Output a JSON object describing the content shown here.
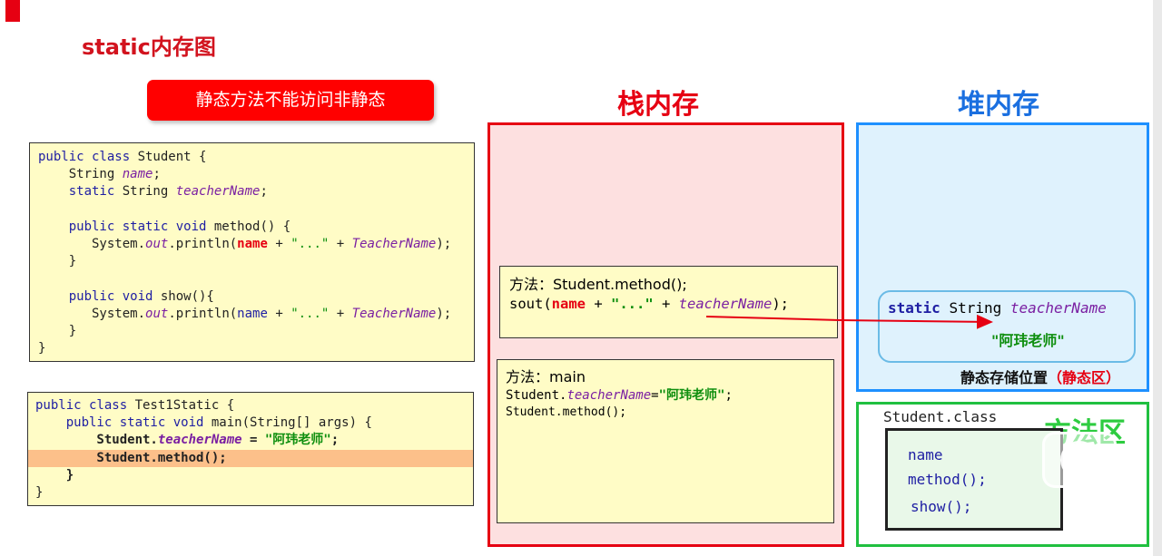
{
  "slide": {
    "title": "static内存图",
    "note": "静态方法不能访问非静态"
  },
  "student_code": {
    "lines": [
      [
        {
          "t": "public class ",
          "c": "kw"
        },
        {
          "t": "Student {",
          "c": ""
        }
      ],
      [
        {
          "t": "    String ",
          "c": ""
        },
        {
          "t": "name",
          "c": "fld"
        },
        {
          "t": ";",
          "c": ""
        }
      ],
      [
        {
          "t": "    static ",
          "c": "kw"
        },
        {
          "t": "String ",
          "c": ""
        },
        {
          "t": "teacherName",
          "c": "fld"
        },
        {
          "t": ";",
          "c": ""
        }
      ],
      [],
      [
        {
          "t": "    public static void ",
          "c": "kw"
        },
        {
          "t": "method() {",
          "c": ""
        }
      ],
      [
        {
          "t": "       System.",
          "c": ""
        },
        {
          "t": "out",
          "c": "fld"
        },
        {
          "t": ".println(",
          "c": ""
        },
        {
          "t": "name",
          "c": "redb"
        },
        {
          "t": " + ",
          "c": ""
        },
        {
          "t": "\"...\"",
          "c": "grn"
        },
        {
          "t": " + ",
          "c": ""
        },
        {
          "t": "TeacherName",
          "c": "fld"
        },
        {
          "t": ");",
          "c": ""
        }
      ],
      [
        {
          "t": "    }",
          "c": ""
        }
      ],
      [],
      [
        {
          "t": "    public void ",
          "c": "kw"
        },
        {
          "t": "show(){",
          "c": ""
        }
      ],
      [
        {
          "t": "       System.",
          "c": ""
        },
        {
          "t": "out",
          "c": "fld"
        },
        {
          "t": ".println(",
          "c": ""
        },
        {
          "t": "name",
          "c": "kw"
        },
        {
          "t": " + ",
          "c": ""
        },
        {
          "t": "\"...\"",
          "c": "grn"
        },
        {
          "t": " + ",
          "c": ""
        },
        {
          "t": "TeacherName",
          "c": "fld"
        },
        {
          "t": ");",
          "c": ""
        }
      ],
      [
        {
          "t": "    }",
          "c": ""
        }
      ],
      [
        {
          "t": "}",
          "c": ""
        }
      ]
    ]
  },
  "test_code": {
    "highlight_line": 3,
    "lines": [
      [
        {
          "t": "public class ",
          "c": "kw"
        },
        {
          "t": "Test1Static {",
          "c": ""
        }
      ],
      [
        {
          "t": "    public static void ",
          "c": "kw"
        },
        {
          "t": "main(String[] args) {",
          "c": ""
        }
      ],
      [
        {
          "t": "        Student.",
          "c": "b"
        },
        {
          "t": "teacherName",
          "c": "fld b"
        },
        {
          "t": " = ",
          "c": "b"
        },
        {
          "t": "\"阿玮老师\"",
          "c": "grnb"
        },
        {
          "t": ";",
          "c": "b"
        }
      ],
      [
        {
          "t": "        Student.method();",
          "c": "b"
        }
      ],
      [
        {
          "t": "    }",
          "c": "b"
        }
      ],
      [
        {
          "t": "}",
          "c": ""
        }
      ]
    ]
  },
  "stack": {
    "title": "栈内存",
    "method_frame": {
      "line1": [
        {
          "t": "方法：Student.method();",
          "c": ""
        }
      ],
      "line2": [
        {
          "t": "sout(",
          "c": ""
        },
        {
          "t": "name",
          "c": "redb"
        },
        {
          "t": " + ",
          "c": ""
        },
        {
          "t": "\"...\"",
          "c": "grnb"
        },
        {
          "t": " + ",
          "c": ""
        },
        {
          "t": "teacherName",
          "c": "fld"
        },
        {
          "t": ");",
          "c": ""
        }
      ]
    },
    "main_frame": {
      "line1": [
        {
          "t": "方法：main",
          "c": ""
        }
      ],
      "line2": [
        {
          "t": "Student.",
          "c": ""
        },
        {
          "t": "teacherName",
          "c": "fld"
        },
        {
          "t": "=",
          "c": ""
        },
        {
          "t": "\"阿玮老师\"",
          "c": "grnb"
        },
        {
          "t": ";",
          "c": ""
        }
      ],
      "line3": [
        {
          "t": "Student.method();",
          "c": ""
        }
      ]
    }
  },
  "heap": {
    "title": "堆内存",
    "static_decl": [
      {
        "t": "static ",
        "c": "kw b"
      },
      {
        "t": "String ",
        "c": ""
      },
      {
        "t": "teacherName",
        "c": "fld"
      }
    ],
    "static_value": "\"阿玮老师\"",
    "static_area_label": "静态存储位置",
    "static_area_tag": "（静态区）"
  },
  "method_area": {
    "title": "方法区",
    "class_name": "Student.class",
    "members": [
      "name",
      "method();",
      "show();"
    ]
  },
  "colors": {
    "red": "#e60012",
    "blue": "#1a6fe0",
    "green": "#2ecc40",
    "purple": "#7a1fa2",
    "keyword": "#1e1ea3"
  },
  "icons": {
    "play": "play-icon"
  }
}
